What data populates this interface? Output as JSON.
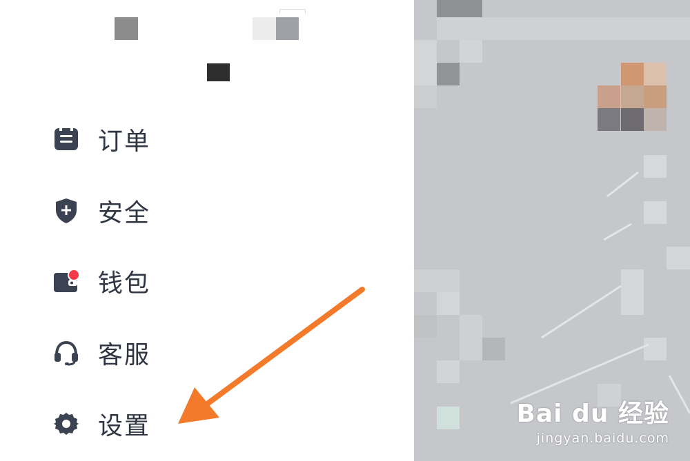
{
  "menu": {
    "items": [
      {
        "key": "orders",
        "label": "订单",
        "icon": "orders-icon"
      },
      {
        "key": "security",
        "label": "安全",
        "icon": "shield-plus-icon"
      },
      {
        "key": "wallet",
        "label": "钱包",
        "icon": "wallet-icon",
        "badge": true
      },
      {
        "key": "support",
        "label": "客服",
        "icon": "headset-icon"
      },
      {
        "key": "settings",
        "label": "设置",
        "icon": "gear-icon"
      }
    ]
  },
  "watermark": {
    "logo": "Bai du 经验",
    "url": "jingyan.baidu.com"
  },
  "colors": {
    "icon": "#3b4252",
    "label": "#2f3542",
    "badge": "#f23b4a",
    "arrow": "#f47a2b",
    "map_bg": "#c5c7cb"
  }
}
